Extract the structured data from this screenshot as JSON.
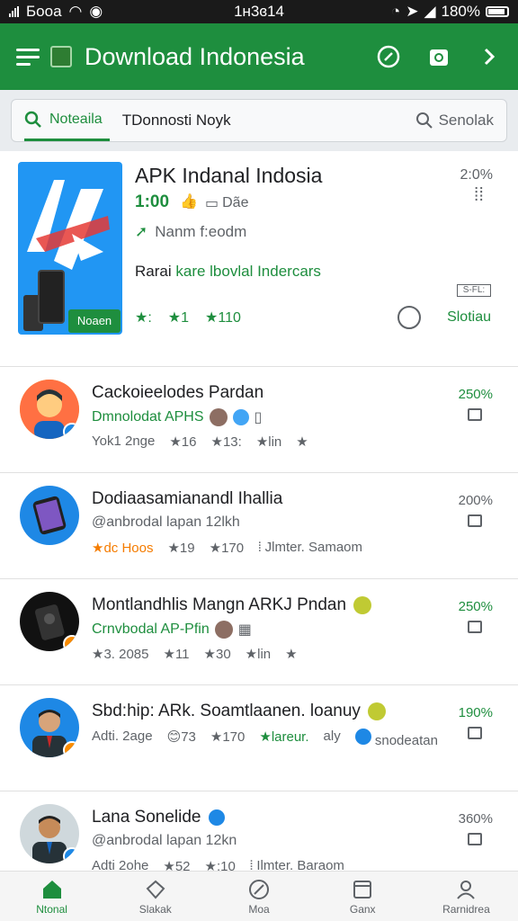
{
  "status": {
    "carrier": "Боoa",
    "time": "1ʜ3ɞ14",
    "battery": "180%"
  },
  "appbar": {
    "title": "Download Indonesia"
  },
  "search": {
    "tab_label": "Noteaila",
    "query": "TDonnosti Noyk",
    "search_label": "Senolak"
  },
  "featured": {
    "title": "APK Indanal Indosia",
    "price": "1:00",
    "type_label": "Dãe",
    "developer": "Nanm f:eodm",
    "desc_prefix": "Rarai",
    "desc_highlight": "kare lbovlal Indercars",
    "badge": "Noaen",
    "ratings": [
      "★:",
      "★1",
      "★110"
    ],
    "percent": "2:0%",
    "size": "S-FL:",
    "action": "Slotiau"
  },
  "rows": [
    {
      "name": "Cackoieelodes Pardan",
      "sub": "Dmnolodat APHS",
      "stats": [
        "Yok1 2nge",
        "★16",
        "★13:",
        "★lin",
        "★"
      ],
      "percent": "250%"
    },
    {
      "name": "Dodiaasamianandl Ihallia",
      "sub": "@anbrodal lapan 12lkh",
      "stats": [
        "★dc Hoos",
        "★19",
        "★170",
        "⦙ Jlmter. Samaom"
      ],
      "percent": "200%"
    },
    {
      "name": "Montlandhlis Mangn ARKJ Pndan",
      "sub": "Crnvbodal AP-Pfin",
      "stats": [
        "★3. 2085",
        "★11",
        "★30",
        "★lin",
        "★"
      ],
      "percent": "250%"
    },
    {
      "name": "Sbd:hip: ARk. Soamtlaanen. loanuy",
      "sub": "",
      "stats": [
        "Adti. 2age",
        "73",
        "★170",
        "★lareur.",
        "aly",
        "snodeatan"
      ],
      "percent": "190%"
    },
    {
      "name": "Lana Sonelide",
      "sub": "@anbrodal lapan 12kn",
      "stats": [
        "Adti 2ohe",
        "★52",
        "★:10",
        "⦙ Ilmter. Baraom"
      ],
      "percent": "360%"
    }
  ],
  "nav": [
    "Ntonal",
    "Slakak",
    "Moa",
    "Ganx",
    "Rarnidrea"
  ]
}
